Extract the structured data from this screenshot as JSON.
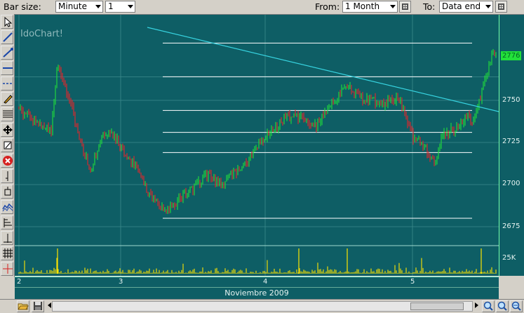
{
  "toolbar": {
    "bar_size_label": "Bar size:",
    "bar_size_value": "Minute",
    "bar_count_value": "1",
    "from_label": "From:",
    "from_value": "1 Month",
    "to_label": "To:",
    "to_value": "Data end"
  },
  "chart": {
    "watermark": "IdoChart!",
    "current_price": "2776",
    "price_ticks": [
      "2750",
      "2725",
      "2700",
      "2675"
    ],
    "volume_tick": "25K",
    "day_ticks": [
      "2",
      "3",
      "4",
      "5"
    ],
    "month_label": "Noviembre 2009",
    "colors": {
      "background": "#0e5e65",
      "up_bar": "#22e03a",
      "down_bar": "#e8242a",
      "volume": "#ffe500",
      "trendline": "#37d3e0",
      "fib_lines": "#ffffff"
    }
  },
  "chart_data": {
    "type": "candlestick",
    "ylim": [
      2670,
      2785
    ],
    "y_ticks": [
      2750,
      2725,
      2700,
      2675
    ],
    "x_ticks": [
      "2",
      "3",
      "4",
      "5"
    ],
    "xlabel": "Noviembre 2009",
    "last_price": 2776,
    "fib_levels": [
      2680,
      2719,
      2731,
      2744,
      2764,
      2784
    ],
    "price_path": [
      [
        2,
        2745
      ],
      [
        2.15,
        2738
      ],
      [
        2.32,
        2732
      ],
      [
        2.38,
        2771
      ],
      [
        2.5,
        2750
      ],
      [
        2.6,
        2727
      ],
      [
        2.7,
        2708
      ],
      [
        2.82,
        2728
      ],
      [
        2.9,
        2733
      ],
      [
        3.0,
        2722
      ],
      [
        3.1,
        2711
      ],
      [
        3.2,
        2694
      ],
      [
        3.3,
        2684
      ],
      [
        3.45,
        2694
      ],
      [
        3.6,
        2706
      ],
      [
        3.7,
        2700
      ],
      [
        3.85,
        2712
      ],
      [
        4.0,
        2728
      ],
      [
        4.15,
        2740
      ],
      [
        4.25,
        2740
      ],
      [
        4.35,
        2735
      ],
      [
        4.45,
        2748
      ],
      [
        4.55,
        2758
      ],
      [
        4.65,
        2752
      ],
      [
        4.8,
        2748
      ],
      [
        4.9,
        2752
      ],
      [
        4.95,
        2742
      ],
      [
        5.0,
        2728
      ],
      [
        5.1,
        2722
      ],
      [
        5.18,
        2712
      ],
      [
        5.25,
        2730
      ],
      [
        5.35,
        2733
      ],
      [
        5.45,
        2741
      ],
      [
        5.5,
        2737
      ],
      [
        5.58,
        2760
      ],
      [
        5.65,
        2777
      ]
    ],
    "volume_ylim": [
      0,
      40000
    ],
    "volume_ticks": [
      "25K"
    ]
  },
  "icons": [
    "arrow-pointer-icon",
    "line-icon",
    "trend-line-icon",
    "horizontal-line-icon",
    "horizontal-ray-icon",
    "pencil-icon",
    "fibonacci-icon",
    "move-icon",
    "eraser-icon",
    "delete-icon",
    "vertical-line-icon",
    "zoom-window-icon",
    "chart-type-icon",
    "tool-13-icon",
    "tool-14-icon",
    "grid-icon",
    "crosshair-icon"
  ]
}
